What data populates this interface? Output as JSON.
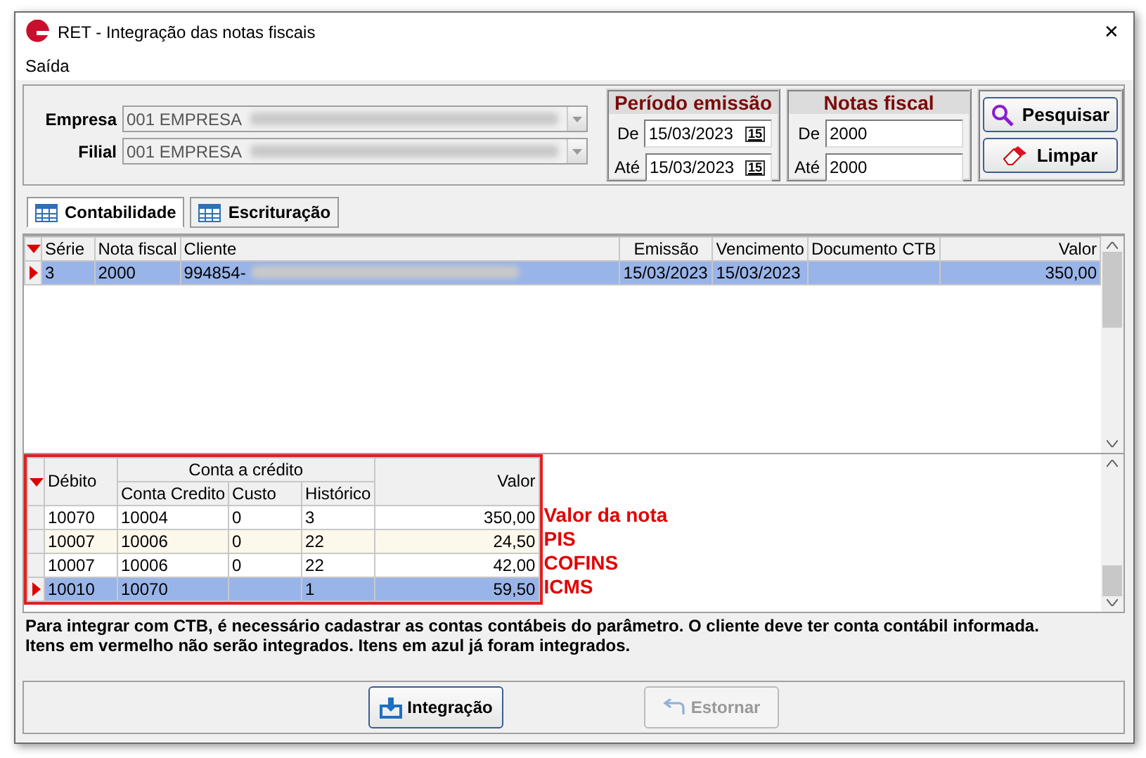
{
  "window": {
    "title": "RET - Integração das notas fiscais",
    "close": "✕"
  },
  "menu": [
    {
      "label": "Saída"
    }
  ],
  "filters": [
    {
      "label": "Empresa",
      "value": "001 EMPRESA"
    },
    {
      "label": "Filial",
      "value": "001 EMPRESA"
    }
  ],
  "periodo": {
    "title": "Período emissão",
    "fields": [
      {
        "label": "De",
        "value": "15/03/2023",
        "calendar": "15"
      },
      {
        "label": "Até",
        "value": "15/03/2023",
        "calendar": "15"
      }
    ]
  },
  "notas": {
    "title": "Notas fiscal",
    "fields": [
      {
        "label": "De",
        "value": "2000"
      },
      {
        "label": "Até",
        "value": "2000"
      }
    ]
  },
  "buttons": [
    {
      "label": "Pesquisar",
      "kind": "search"
    },
    {
      "label": "Limpar",
      "kind": "clear"
    }
  ],
  "tabs": [
    {
      "label": "Contabilidade",
      "selected": true
    },
    {
      "label": "Escrituração",
      "selected": false
    }
  ],
  "notes_grid": {
    "columns": [
      "Série",
      "Nota fiscal",
      "Cliente",
      "Emissão",
      "Vencimento",
      "Documento CTB",
      "Valor"
    ],
    "rows": [
      {
        "cells": [
          "3",
          "2000",
          "994854-",
          "15/03/2023",
          "15/03/2023",
          "",
          "350,00"
        ],
        "selected": true
      }
    ]
  },
  "entries_grid": {
    "group_header": "Conta a crédito",
    "columns": [
      "Débito",
      "Conta Credito",
      "Custo",
      "Histórico",
      "Valor"
    ],
    "rows": [
      {
        "cells": [
          "10070",
          "10004",
          "0",
          "3",
          "350,00"
        ],
        "selected": false,
        "shaded": false,
        "annotation": "Valor da nota"
      },
      {
        "cells": [
          "10007",
          "10006",
          "0",
          "22",
          "24,50"
        ],
        "selected": false,
        "shaded": true,
        "annotation": "PIS"
      },
      {
        "cells": [
          "10007",
          "10006",
          "0",
          "22",
          "42,00"
        ],
        "selected": false,
        "shaded": false,
        "annotation": "COFINS"
      },
      {
        "cells": [
          "10010",
          "10070",
          "",
          "1",
          "59,50"
        ],
        "selected": true,
        "shaded": false,
        "annotation": "ICMS"
      }
    ]
  },
  "info": [
    "Para integrar com CTB, é necessário cadastrar as contas contábeis do parâmetro. O cliente deve ter conta contábil informada.",
    "Itens em vermelho não serão integrados. Itens em azul já foram integrados."
  ],
  "actions": [
    {
      "label": "Integração",
      "disabled": false
    },
    {
      "label": "Estornar",
      "disabled": true
    }
  ]
}
